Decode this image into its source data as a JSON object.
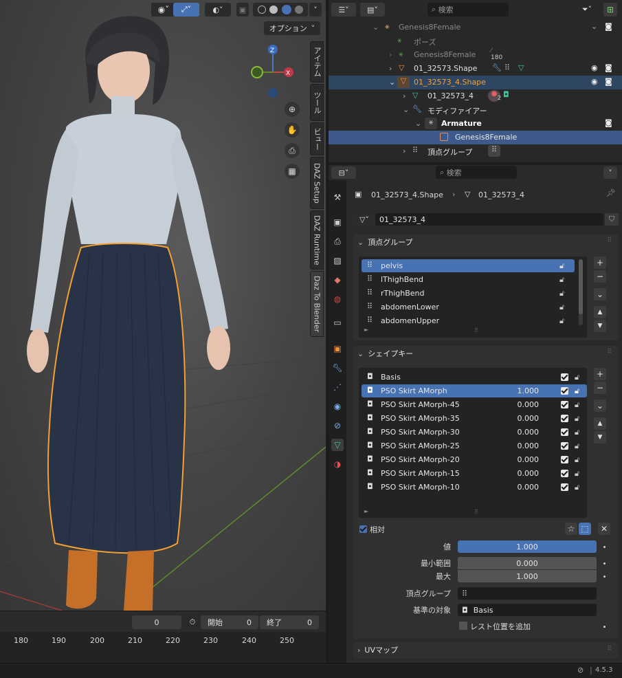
{
  "viewport": {
    "options_label": "オプション",
    "gizmo": {
      "z": "Z",
      "x": "X"
    },
    "n_tabs": [
      "アイテム",
      "ツール",
      "ビュー",
      "DAZ Setup",
      "DAZ Runtime",
      "Daz To Blender"
    ]
  },
  "timeline": {
    "current_frame": "0",
    "start_label": "開始",
    "start_value": "0",
    "end_label": "終了",
    "end_value": "0",
    "ruler": [
      "180",
      "190",
      "200",
      "210",
      "220",
      "230",
      "240",
      "250"
    ]
  },
  "outliner": {
    "search_placeholder": "検索",
    "rows": [
      {
        "label": "Genesis8Female",
        "dim": true
      },
      {
        "label": "ポーズ",
        "dim": true
      },
      {
        "label": "Genesis8Female",
        "dim": true,
        "badge": "180"
      },
      {
        "label": "01_32573.Shape"
      },
      {
        "label": "01_32573_4.Shape",
        "highlight": true
      },
      {
        "label": "01_32573_4",
        "badge": "2"
      },
      {
        "label": "モディファイアー"
      },
      {
        "label": "Armature"
      },
      {
        "label": "Genesis8Female",
        "selected": true
      },
      {
        "label": "頂点グループ"
      }
    ]
  },
  "properties": {
    "search_placeholder": "検索",
    "breadcrumb": {
      "object": "01_32573_4.Shape",
      "mesh": "01_32573_4"
    },
    "mesh_name": "01_32573_4",
    "vertex_groups": {
      "title": "頂点グループ",
      "items": [
        "pelvis",
        "lThighBend",
        "rThighBend",
        "abdomenLower",
        "abdomenUpper"
      ]
    },
    "shape_keys": {
      "title": "シェイプキー",
      "items": [
        {
          "name": "Basis",
          "value": ""
        },
        {
          "name": "PSO Skirt AMorph",
          "value": "1.000"
        },
        {
          "name": "PSO Skirt AMorph-45",
          "value": "0.000"
        },
        {
          "name": "PSO Skirt AMorph-35",
          "value": "0.000"
        },
        {
          "name": "PSO Skirt AMorph-30",
          "value": "0.000"
        },
        {
          "name": "PSO Skirt AMorph-25",
          "value": "0.000"
        },
        {
          "name": "PSO Skirt AMorph-20",
          "value": "0.000"
        },
        {
          "name": "PSO Skirt AMorph-15",
          "value": "0.000"
        },
        {
          "name": "PSO Skirt AMorph-10",
          "value": "0.000"
        }
      ],
      "relative_label": "相対",
      "value_label": "値",
      "value": "1.000",
      "min_label": "最小範囲",
      "min": "0.000",
      "max_label": "最大",
      "max": "1.000",
      "vgroup_label": "頂点グループ",
      "reference_label": "基準の対象",
      "reference": "Basis",
      "rest_label": "レスト位置を追加"
    },
    "uv_title": "UVマップ"
  },
  "status": {
    "version": "4.5.3"
  },
  "colors": {
    "accent": "#4772b3",
    "selection_orange": "#f5a030",
    "highlight_row": "#2f4663"
  }
}
